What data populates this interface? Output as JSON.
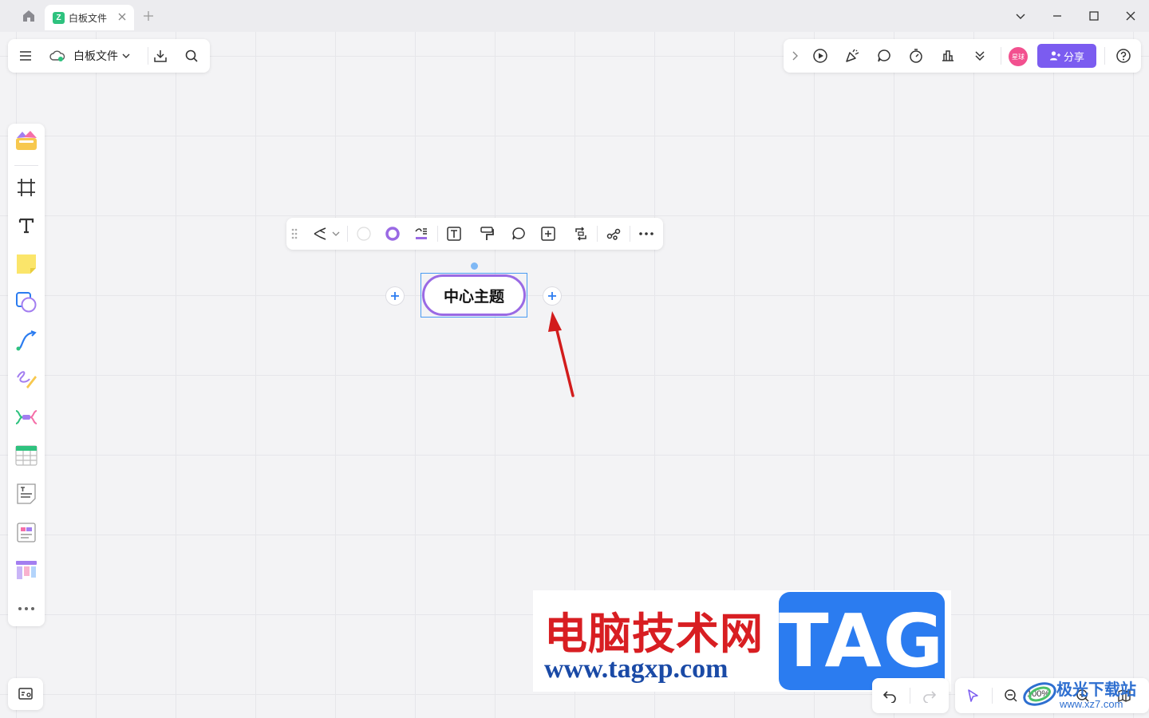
{
  "titlebar": {
    "tab_label": "白板文件",
    "tab_logo": "Z"
  },
  "file_menu": {
    "filename": "白板文件"
  },
  "top_right": {
    "avatar_text": "星球",
    "share_label": "分享"
  },
  "mindmap": {
    "center_topic": "中心主题"
  },
  "zoom": {
    "value": "100%"
  },
  "watermark": {
    "title": "电脑技术网",
    "url": "www.tagxp.com",
    "tag": "TAG",
    "site2_title": "极光下载站",
    "site2_url": "www.xz7.com"
  },
  "colors": {
    "accent": "#7b5cf0",
    "node_border": "#9a6ae4",
    "selection": "#4a9bf2",
    "arrow": "#d21c1c"
  }
}
